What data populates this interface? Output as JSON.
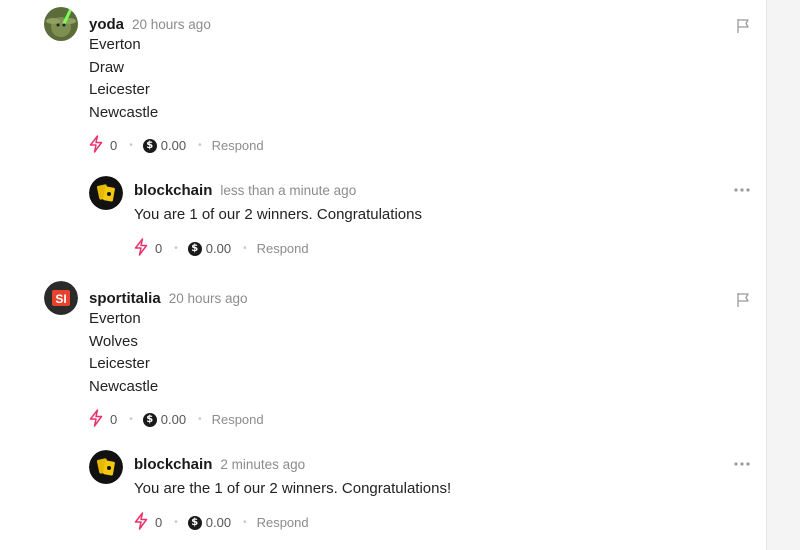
{
  "colors": {
    "zap": "#e8336d",
    "muted": "#8c8c8c"
  },
  "comments": [
    {
      "author": "yoda",
      "time": "20 hours ago",
      "lines": [
        "Everton",
        "Draw",
        "Leicester",
        "Newcastle"
      ],
      "zaps": "0",
      "tip": "0.00",
      "respond": "Respond",
      "corner_icon": "flag-icon",
      "reply": {
        "author": "blockchain",
        "time": "less than a minute ago",
        "lines": [
          "You are 1 of our 2 winners. Congratulations"
        ],
        "zaps": "0",
        "tip": "0.00",
        "respond": "Respond",
        "corner_icon": "more-icon"
      }
    },
    {
      "author": "sportitalia",
      "avatar_text": "SI",
      "time": "20 hours ago",
      "lines": [
        "Everton",
        "Wolves",
        "Leicester",
        "Newcastle"
      ],
      "zaps": "0",
      "tip": "0.00",
      "respond": "Respond",
      "corner_icon": "flag-icon",
      "reply": {
        "author": "blockchain",
        "time": "2 minutes ago",
        "lines": [
          "You are the 1 of our 2 winners. Congratulations!"
        ],
        "zaps": "0",
        "tip": "0.00",
        "respond": "Respond",
        "corner_icon": "more-icon"
      }
    }
  ]
}
